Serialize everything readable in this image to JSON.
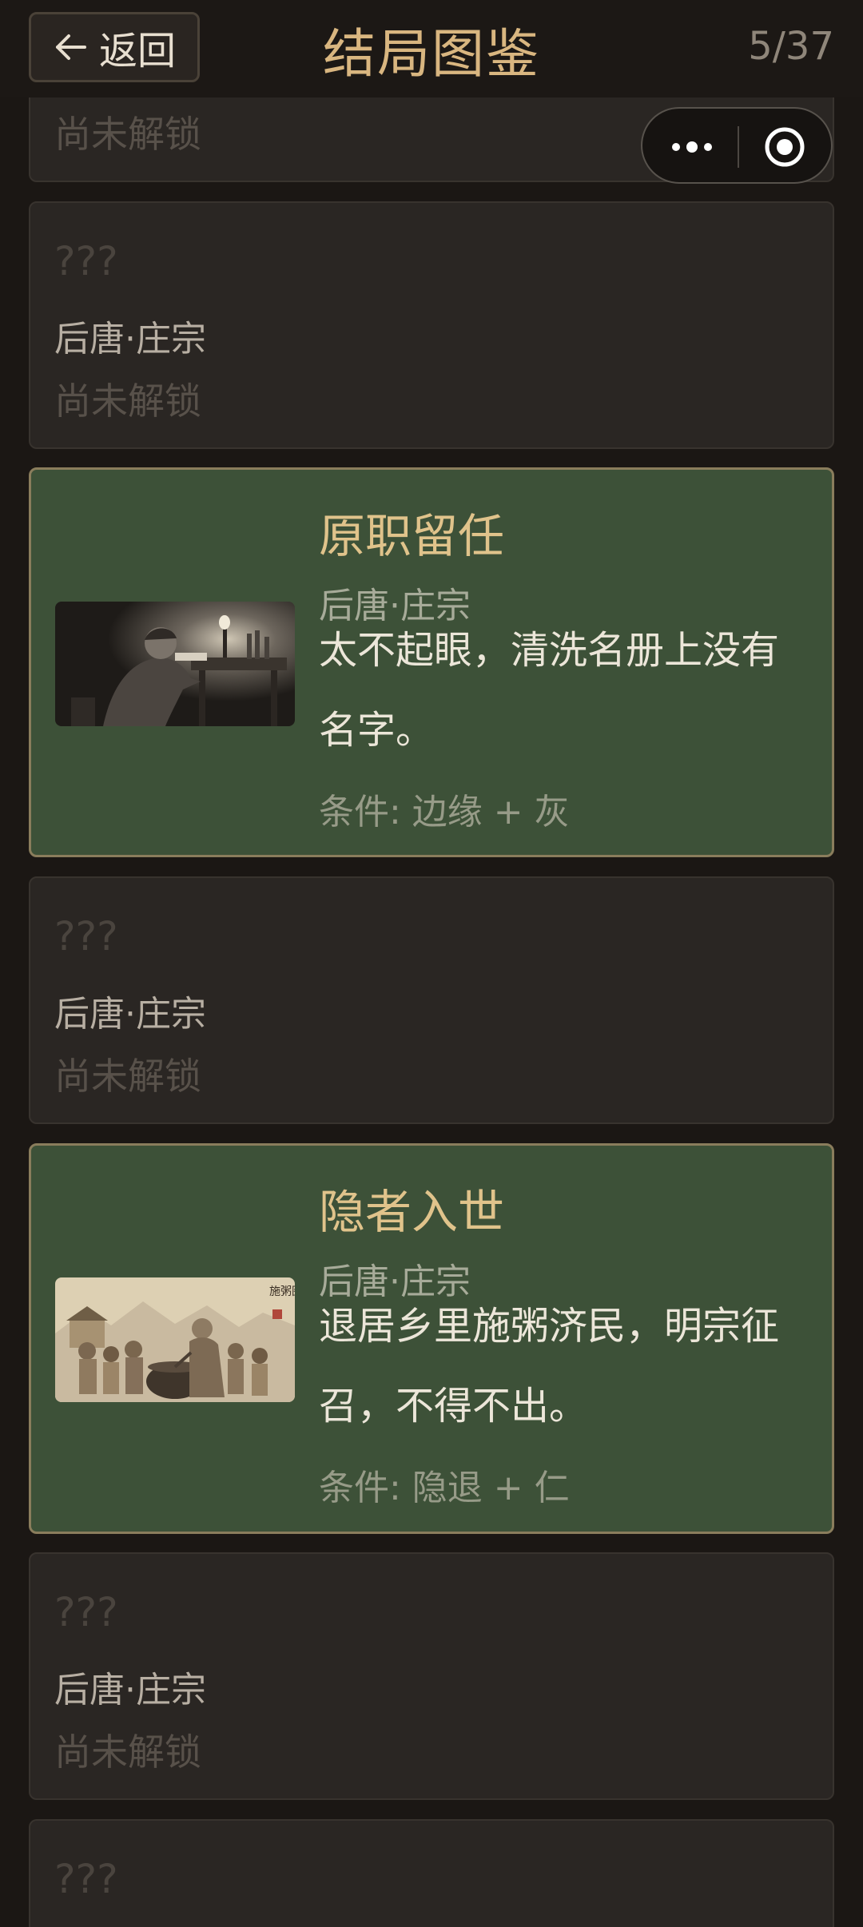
{
  "header": {
    "back_label": "返回",
    "title": "结局图鉴",
    "progress": "5/37"
  },
  "capsule": {
    "more_icon": "more-dots-icon",
    "close_icon": "target-circle-icon"
  },
  "cards": [
    {
      "status": "尚未解锁"
    },
    {
      "title": "???",
      "era": "后唐·庄宗",
      "status": "尚未解锁"
    },
    {
      "title": "原职留任",
      "era": "后唐·庄宗",
      "description": "太不起眼，清洗名册上没有名字。",
      "condition": "条件: 边缘 + 灰"
    },
    {
      "title": "???",
      "era": "后唐·庄宗",
      "status": "尚未解锁"
    },
    {
      "title": "隐者入世",
      "era": "后唐·庄宗",
      "description": "退居乡里施粥济民，明宗征召，不得不出。",
      "condition": "条件: 隐退 + 仁",
      "image_text": "施粥图"
    },
    {
      "title": "???",
      "era": "后唐·庄宗",
      "status": "尚未解锁"
    },
    {
      "title": "???"
    }
  ],
  "colors": {
    "background": "#1b1714",
    "locked_card": "#2a2623",
    "unlocked_card": "#3d5138",
    "accent_gold": "#d9b680"
  }
}
